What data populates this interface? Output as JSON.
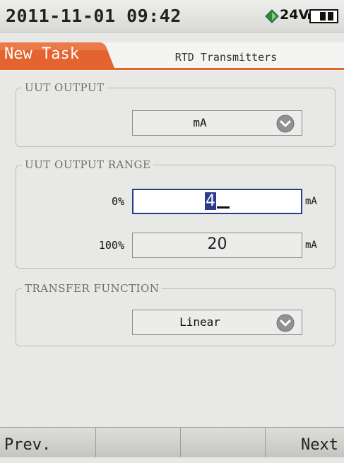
{
  "status": {
    "datetime": "2011-11-01 09:42",
    "voltage": "24V",
    "icons": [
      "power-icon",
      "battery-icon"
    ]
  },
  "tabs": {
    "active_label": "New Task",
    "title": "RTD Transmitters"
  },
  "uut_output": {
    "legend": "UUT OUTPUT",
    "selected": "mA"
  },
  "uut_output_range": {
    "legend": "UUT OUTPUT RANGE",
    "rows": [
      {
        "label": "0%",
        "value": "4",
        "unit": "mA"
      },
      {
        "label": "100%",
        "value": "20",
        "unit": "mA"
      }
    ]
  },
  "transfer_function": {
    "legend": "TRANSFER FUNCTION",
    "selected": "Linear"
  },
  "softkeys": {
    "prev": "Prev.",
    "next": "Next"
  },
  "colors": {
    "accent": "#e3642e",
    "focus": "#2c3c8c",
    "power_icon": "#2e8b3a"
  }
}
